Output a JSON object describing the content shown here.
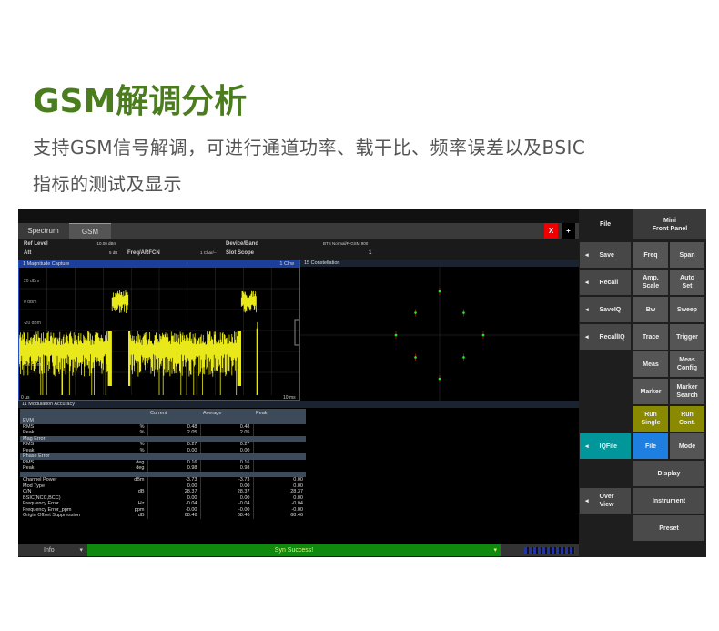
{
  "title": "GSM解调分析",
  "subtitle_lines": [
    "支持GSM信号解调，可进行通道功率、载干比、频率误差以及BSIC",
    "指标的测试及显示"
  ],
  "tabs": [
    {
      "label": "Spectrum"
    },
    {
      "label": "GSM",
      "active": true
    }
  ],
  "close_label": "X",
  "add_label": "+",
  "info": {
    "ref_level_label": "Ref Level",
    "ref_level": "-10.00 dBm",
    "att_label": "Att",
    "att": "5 dB",
    "freq_label": "Freq/ARFCN",
    "freq_suffix": "1 Char/--",
    "device_label": "Device/Band",
    "device": "BTS Normal/P-GSM 900",
    "slot_label": "Slot Scope",
    "slot": "1"
  },
  "magnitude": {
    "header": "1 Magnitude Capture",
    "badge": "1 Clrw",
    "y_ticks": [
      "20 dBm",
      "0 dBm",
      "-20 dBm",
      "-40 dBm",
      "-60 dBm"
    ],
    "x_start": "0 µs",
    "x_end": "10 ms",
    "trace_color": "#e8e81a"
  },
  "constellation": {
    "header": "15 Constellation"
  },
  "modacc": {
    "header": "11 Modulation Accuracy",
    "columns": [
      "",
      "",
      "Current",
      "Average",
      "Peak"
    ],
    "rows": [
      {
        "sec": "EVM"
      },
      [
        "RMS",
        "%",
        "0.48",
        "0.48",
        ""
      ],
      [
        "Peak",
        "%",
        "2.05",
        "2.05",
        ""
      ],
      {
        "sec": "Mag Error"
      },
      [
        "RMS",
        "%",
        "0.27",
        "0.27",
        ""
      ],
      [
        "Peak",
        "%",
        "0.00",
        "0.00",
        ""
      ],
      {
        "sec": "Phase Error"
      },
      [
        "RMS",
        "deg",
        "0.16",
        "0.16",
        ""
      ],
      [
        "Peak",
        "deg",
        "0.98",
        "0.98",
        ""
      ],
      {
        "sec": ""
      },
      [
        "Channel Power",
        "dBm",
        "-3.73",
        "-3.73",
        "0.00"
      ],
      [
        "Mod Type",
        "",
        "0.00",
        "0.00",
        "0.00"
      ],
      [
        "C/N",
        "dB",
        "28.37",
        "28.37",
        "28.37"
      ],
      [
        "BSIC(NCC,BCC)",
        "",
        "0.00",
        "0.00",
        "0.00"
      ],
      [
        "Frequency Error",
        "Hz",
        "-0.04",
        "-0.04",
        "-0.04"
      ],
      [
        "Frequency Error_ppm",
        "ppm",
        "-0.00",
        "-0.00",
        "-0.00"
      ],
      [
        "Origin Offset Suppression",
        "dB",
        "68.46",
        "68.46",
        "68.46"
      ]
    ]
  },
  "status": {
    "info_label": "Info",
    "message": "Syn Success!"
  },
  "softkeys": {
    "file_header": "File",
    "mini_header": "Mini\nFront Panel",
    "left": [
      "Save",
      "Recall",
      "SaveIQ",
      "RecallIQ",
      "IQFile",
      "Over\nView"
    ],
    "grid": [
      [
        "Freq",
        "Span"
      ],
      [
        "Amp.\nScale",
        "Auto\nSet"
      ],
      [
        "Bw",
        "Sweep"
      ],
      [
        "Trace",
        "Trigger"
      ],
      [
        "Meas",
        "Meas\nConfig"
      ],
      [
        "Marker",
        "Marker\nSearch"
      ],
      [
        "Run\nSingle",
        "Run\nCont."
      ],
      [
        "File",
        "Mode"
      ]
    ],
    "wide": [
      "Display",
      "Instrument",
      "Preset"
    ]
  },
  "colors": {
    "title": "#4b7d1f",
    "run": "#8a8a00",
    "iqfile": "#00969a",
    "file": "#1e7fe0",
    "status": "#0f8a0f"
  }
}
